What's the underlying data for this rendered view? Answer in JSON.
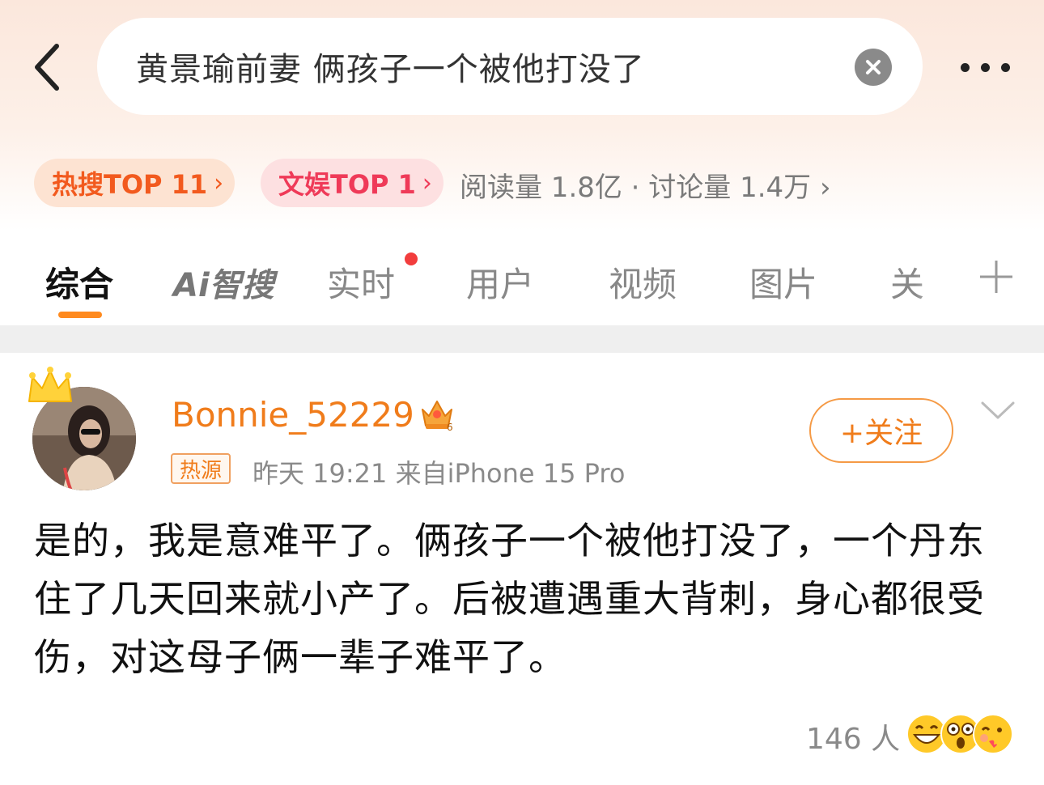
{
  "search": {
    "query": "黄景瑜前妻 俩孩子一个被他打没了"
  },
  "badges": {
    "hot_search": "热搜TOP 11",
    "entertainment": "文娱TOP 1",
    "chevron": "›",
    "stats": "阅读量 1.8亿 · 讨论量 1.4万 ›"
  },
  "tabs": [
    {
      "label": "综合",
      "active": true
    },
    {
      "label": "Ai智搜"
    },
    {
      "label": "实时",
      "has_dot": true
    },
    {
      "label": "用户"
    },
    {
      "label": "视频"
    },
    {
      "label": "图片"
    },
    {
      "label": "关"
    }
  ],
  "post": {
    "username": "Bonnie_52229",
    "source_badge": "热源",
    "meta": "昨天 19:21  来自iPhone 15 Pro",
    "follow_label": "+关注",
    "text": "是的，我是意难平了。俩孩子一个被他打没了，一个丹东住了几天回来就小产了。后被遭遇重大背刺，身心都很受伤，对这母子俩一辈子难平了。",
    "reactions_count": "146 人"
  },
  "colors": {
    "accent_orange": "#f07c1b",
    "hot_red": "#ef3a58",
    "tab_underline": "#ff8a1e"
  },
  "icons": [
    "back-arrow-icon",
    "clear-icon",
    "more-icon",
    "crown-icon",
    "vip-crown-icon",
    "chevron-down-icon",
    "plus-icon",
    "grin-emoji-icon",
    "surprised-emoji-icon",
    "kiss-emoji-icon"
  ]
}
